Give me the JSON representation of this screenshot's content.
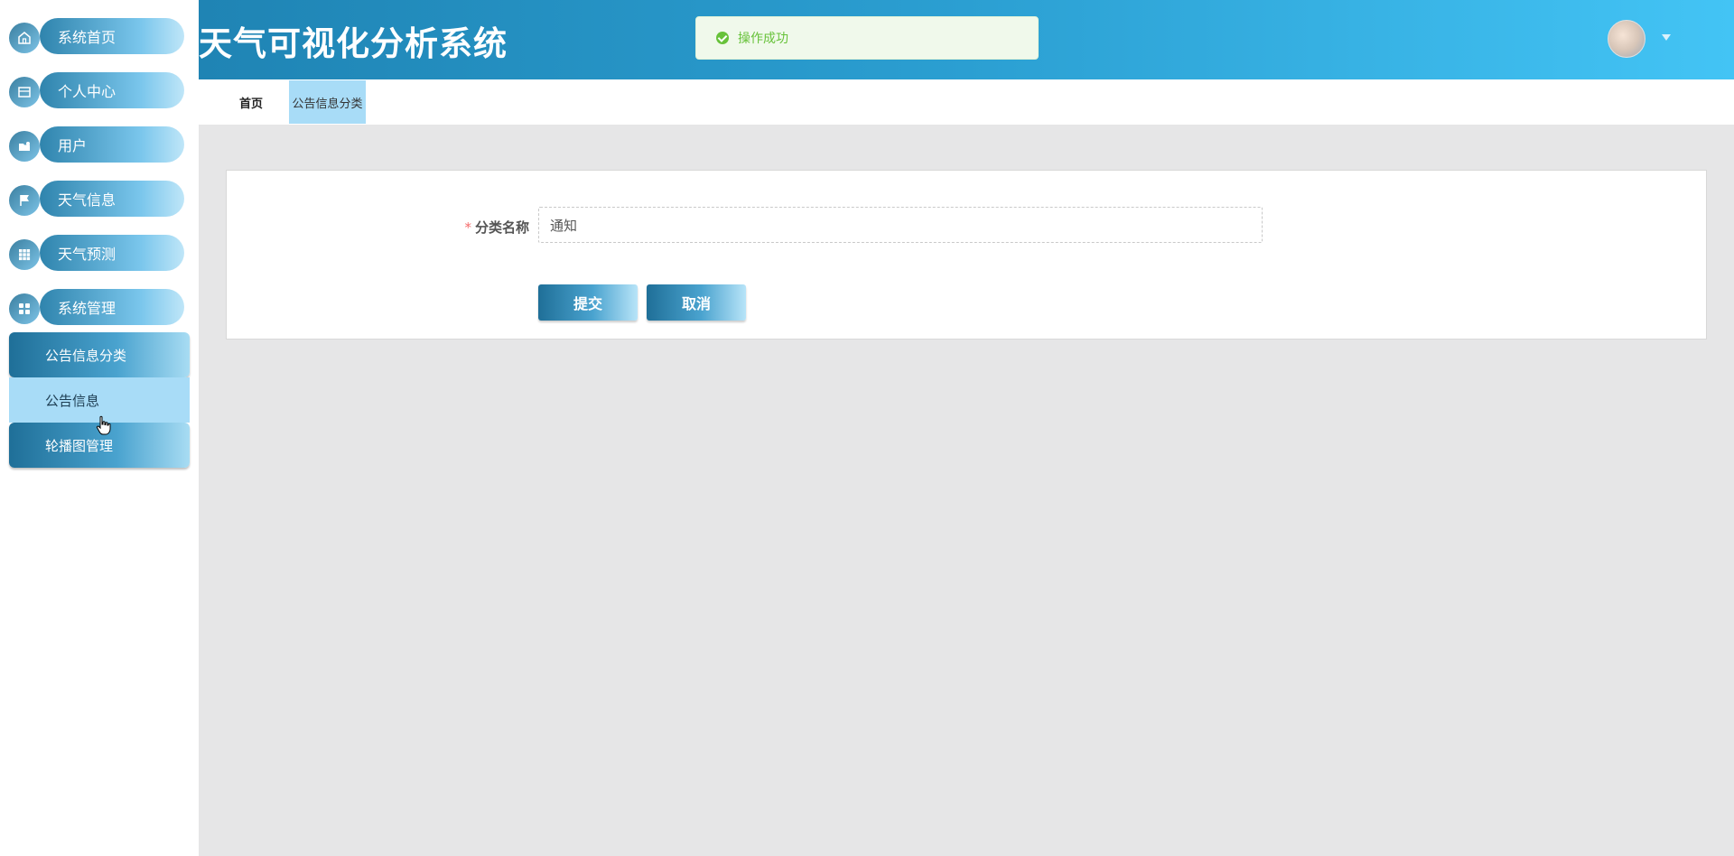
{
  "header": {
    "title": "天气可视化分析系统"
  },
  "toast": {
    "message": "操作成功"
  },
  "sidebar": {
    "items": [
      {
        "label": "系统首页",
        "icon": "home-icon"
      },
      {
        "label": "个人中心",
        "icon": "card-icon"
      },
      {
        "label": "用户",
        "icon": "user-folder-icon"
      },
      {
        "label": "天气信息",
        "icon": "flag-icon"
      },
      {
        "label": "天气预测",
        "icon": "grid-icon"
      },
      {
        "label": "系统管理",
        "icon": "apps-icon"
      }
    ],
    "submenu": [
      {
        "label": "公告信息分类",
        "state": "active"
      },
      {
        "label": "公告信息",
        "state": "hover"
      },
      {
        "label": "轮播图管理",
        "state": "normal"
      }
    ]
  },
  "tabs": {
    "home": "首页",
    "active": "公告信息分类"
  },
  "form": {
    "required_mark": "*",
    "name_label": "分类名称",
    "name_value": "通知",
    "submit_label": "提交",
    "cancel_label": "取消"
  },
  "colors": {
    "header_start": "#1f84b4",
    "header_end": "#43c4f5",
    "success": "#67c23a",
    "required": "#f56c6c",
    "page_bg": "#e6e6e7"
  }
}
